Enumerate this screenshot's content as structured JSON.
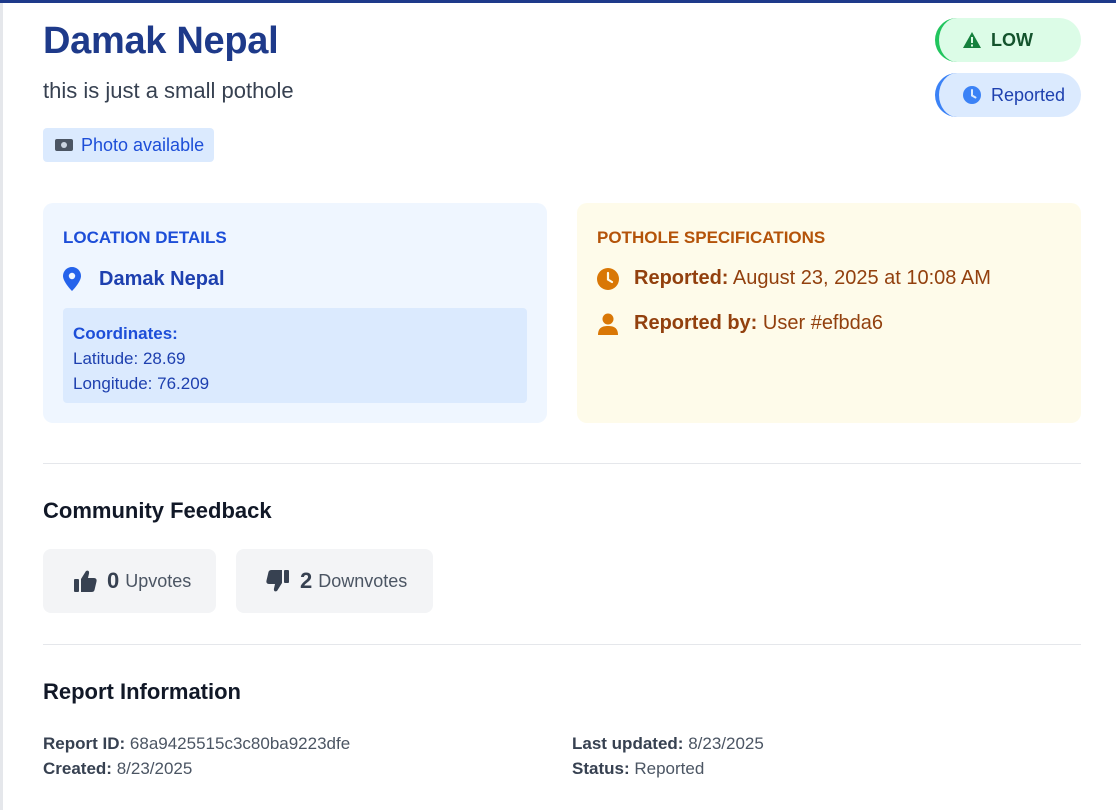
{
  "header": {
    "title": "Damak Nepal",
    "description": "this is just a small pothole",
    "photo_label": "Photo available",
    "photo_icon": "camera-icon"
  },
  "badges": {
    "severity": "LOW",
    "severity_color": "#22c55e",
    "status": "Reported",
    "status_color": "#3b82f6"
  },
  "location": {
    "heading": "LOCATION DETAILS",
    "name": "Damak Nepal",
    "coords_heading": "Coordinates:",
    "latitude": "Latitude: 28.69",
    "longitude": "Longitude: 76.209"
  },
  "specs": {
    "heading": "POTHOLE SPECIFICATIONS",
    "reported_label": "Reported:",
    "reported_value": "August 23, 2025 at 10:08 AM",
    "reported_by_label": "Reported by:",
    "reported_by_value": "User #efbda6"
  },
  "feedback": {
    "heading": "Community Feedback",
    "upvotes_count": "0",
    "upvotes_label": "Upvotes",
    "downvotes_count": "2",
    "downvotes_label": "Downvotes"
  },
  "report_info": {
    "heading": "Report Information",
    "report_id_label": "Report ID:",
    "report_id": "68a9425515c3c80ba9223dfe",
    "created_label": "Created:",
    "created": "8/23/2025",
    "last_updated_label": "Last updated:",
    "last_updated": "8/23/2025",
    "status_label": "Status:",
    "status": "Reported"
  }
}
